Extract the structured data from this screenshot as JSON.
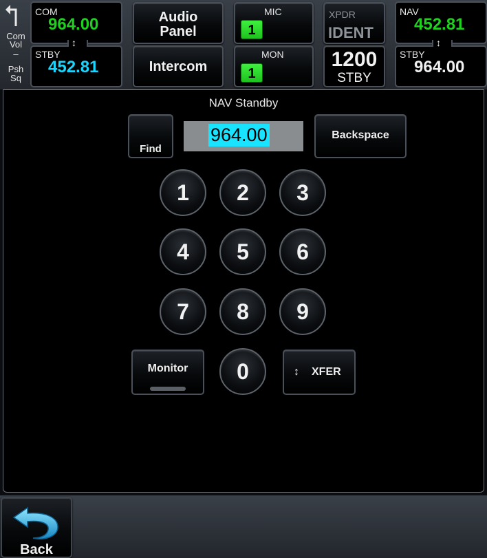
{
  "vol": {
    "lines": [
      "Com",
      "Vol",
      "–",
      "Psh",
      "Sq"
    ]
  },
  "com": {
    "label": "COM",
    "active": "964.00",
    "stby_label": "STBY",
    "standby": "452.81",
    "swap_glyph": "↕"
  },
  "audio_panel": {
    "line1": "Audio",
    "line2": "Panel"
  },
  "intercom": {
    "label": "Intercom"
  },
  "mic": {
    "label": "MIC",
    "value": "1"
  },
  "mon": {
    "label": "MON",
    "value": "1"
  },
  "xpdr": {
    "label": "XPDR",
    "ident": "IDENT",
    "code": "1200",
    "mode": "STBY"
  },
  "nav": {
    "label": "NAV",
    "active": "452.81",
    "stby_label": "STBY",
    "standby": "964.00",
    "swap_glyph": "↕"
  },
  "panel": {
    "title": "NAV Standby",
    "entry_value": "964.00"
  },
  "buttons": {
    "find": "Find",
    "backspace": "Backspace",
    "monitor": "Monitor",
    "xfer": "XFER",
    "xfer_glyph": "↕",
    "back": "Back"
  },
  "keypad": [
    "1",
    "2",
    "3",
    "4",
    "5",
    "6",
    "7",
    "8",
    "9",
    "0"
  ],
  "colors": {
    "active_freq": "#1ed11e",
    "standby_freq": "#19d6ff",
    "indicator": "#2fdc2f",
    "entry_highlight": "#18e4ff"
  }
}
